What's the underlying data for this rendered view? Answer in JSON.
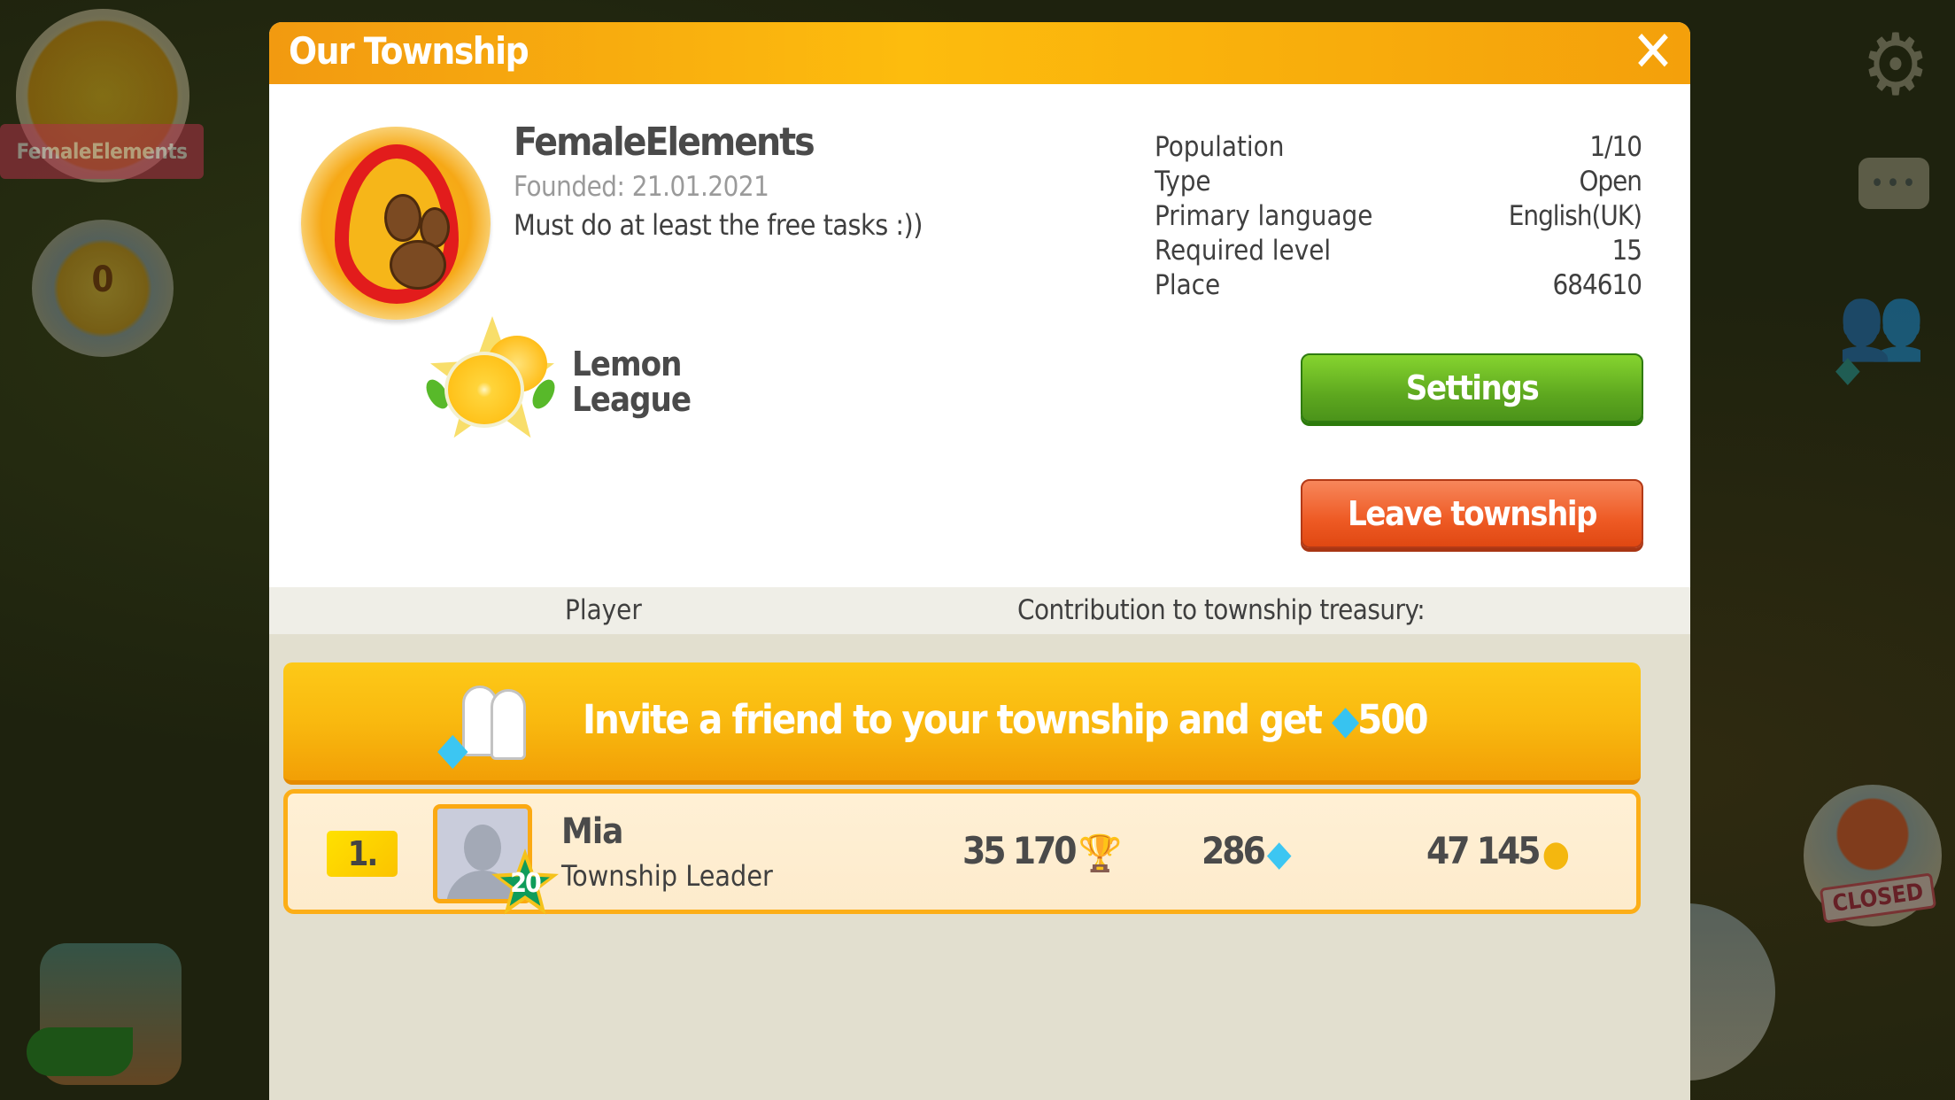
{
  "background_hud": {
    "township_badge_label": "FemaleElements",
    "medal_count": "0",
    "closed_sign": "CLOSED",
    "gear_icon": "⚙",
    "chat_dots": "•••",
    "friends_icon": "👥",
    "gem_icon": "◆"
  },
  "dialog": {
    "title": "Our Township",
    "close_icon": "✕"
  },
  "township": {
    "name": "FemaleElements",
    "founded": "Founded: 21.01.2021",
    "description": "Must do at least the free tasks :))",
    "league": "Lemon League",
    "stats": [
      {
        "label": "Population",
        "value": "1/10"
      },
      {
        "label": "Type",
        "value": "Open"
      },
      {
        "label": "Primary language",
        "value": "English(UK)"
      },
      {
        "label": "Required level",
        "value": "15"
      },
      {
        "label": "Place",
        "value": "684610"
      }
    ]
  },
  "buttons": {
    "settings": "Settings",
    "leave": "Leave township"
  },
  "columns": {
    "player": "Player",
    "contribution": "Contribution to township treasury:"
  },
  "invite": {
    "text": "Invite a friend to your township and get ",
    "gem_icon": "◆",
    "reward": "500"
  },
  "players": [
    {
      "rank": "1.",
      "level": "20",
      "name": "Mia",
      "role": "Township Leader",
      "trophies": "35 170",
      "trophy_icon": "🏆",
      "gems": "286",
      "gem_icon": "◆",
      "coins": "47 145",
      "coin_icon": "●"
    }
  ]
}
